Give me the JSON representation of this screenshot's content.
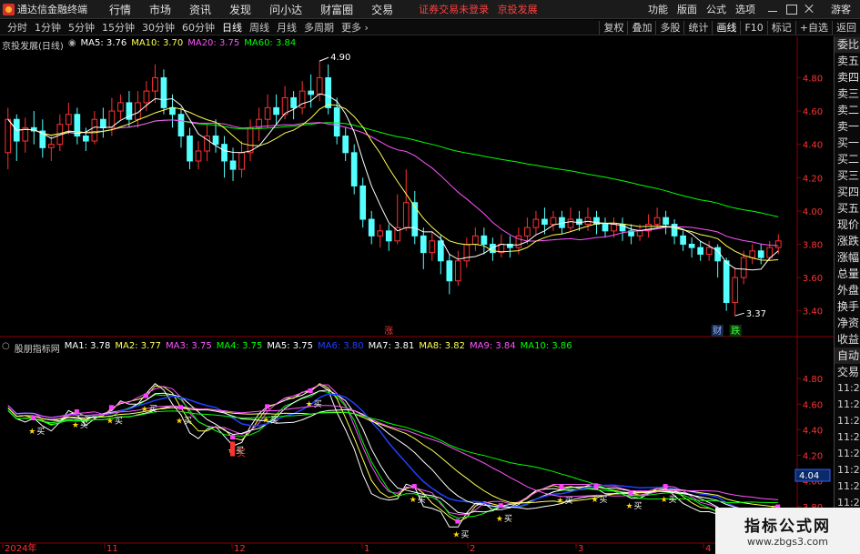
{
  "app": {
    "title": "通达信金融终端",
    "menu": [
      "行情",
      "市场",
      "资讯",
      "发现",
      "问小达",
      "财富圈",
      "交易"
    ],
    "notice": [
      "证券交易未登录",
      "京投发展"
    ],
    "right_menu": [
      "功能",
      "版面",
      "公式",
      "选项"
    ],
    "guest": "游客"
  },
  "toolbar": {
    "periods": [
      "分时",
      "1分钟",
      "5分钟",
      "15分钟",
      "30分钟",
      "60分钟",
      "日线",
      "周线",
      "月线",
      "多周期",
      "更多"
    ],
    "active_period": "日线",
    "buttons": [
      "复权",
      "叠加",
      "多股",
      "统计",
      "画线",
      "F10",
      "标记",
      "+自选",
      "返回"
    ]
  },
  "main_chart": {
    "title": "京投发展(日线)",
    "ma_labels": [
      {
        "text": "MA5: 3.76",
        "color": "#ffffff"
      },
      {
        "text": "MA10: 3.70",
        "color": "#ffff54"
      },
      {
        "text": "MA20: 3.75",
        "color": "#ff54ff"
      },
      {
        "text": "MA60: 3.84",
        "color": "#00ff00"
      }
    ],
    "y_ticks": [
      "4.80",
      "4.60",
      "4.40",
      "4.20",
      "4.00",
      "3.80",
      "3.60",
      "3.40"
    ],
    "high_label": "4.90",
    "low_label": "3.37",
    "zhang_marker": "涨",
    "cai_marker": "财",
    "die_marker": "跌"
  },
  "indicator": {
    "title": "股朋指标网",
    "ma_labels": [
      {
        "text": "MA1: 3.78",
        "color": "#ffffff"
      },
      {
        "text": "MA2: 3.77",
        "color": "#ffff54"
      },
      {
        "text": "MA3: 3.75",
        "color": "#ff54ff"
      },
      {
        "text": "MA4: 3.75",
        "color": "#00ff00"
      },
      {
        "text": "MA5: 3.75",
        "color": "#ffffff"
      },
      {
        "text": "MA6: 3.80",
        "color": "#2040ff"
      },
      {
        "text": "MA7: 3.81",
        "color": "#ffffff"
      },
      {
        "text": "MA8: 3.82",
        "color": "#ffff54"
      },
      {
        "text": "MA9: 3.84",
        "color": "#ff54ff"
      },
      {
        "text": "MA10: 3.86",
        "color": "#00ff00"
      }
    ],
    "y_ticks": [
      "4.80",
      "4.60",
      "4.40",
      "4.20",
      "4.00",
      "3.80",
      "3.60"
    ],
    "current_value": "4.04",
    "buy_label": "买",
    "buy_label_big": "买",
    "star": "★"
  },
  "time_axis": [
    "2024年",
    "11",
    "12",
    "1",
    "2",
    "3",
    "4"
  ],
  "side_panel": {
    "items": [
      "委比",
      "卖五",
      "卖四",
      "卖三",
      "卖二",
      "卖一",
      "买一",
      "买二",
      "买三",
      "买四",
      "买五",
      "现价",
      "涨跌",
      "涨幅",
      "总量",
      "外盘",
      "换手",
      "净资",
      "收益",
      "自动",
      "交易"
    ],
    "times": [
      "11:29",
      "11:29",
      "11:29",
      "11:29",
      "11:29",
      "11:29",
      "11:29",
      "11:29",
      "11:29"
    ]
  },
  "watermark": {
    "title": "指标公式网",
    "url": "www.zbgs3.com"
  },
  "colors": {
    "up": "#ff3232",
    "down": "#54ffff",
    "ma5": "#ffffff",
    "ma10": "#ffff54",
    "ma20": "#ff54ff",
    "ma60": "#00ff00",
    "buy_marker": "#ffd800",
    "axis": "#8b0000",
    "blue": "#2040ff"
  },
  "chart_data": {
    "type": "candlestick",
    "title": "京投发展(日线)",
    "y_range": [
      3.3,
      4.95
    ],
    "indicator_y_range": [
      3.55,
      4.95
    ],
    "candles": [
      [
        4.35,
        4.55,
        4.62,
        4.25
      ],
      [
        4.55,
        4.42,
        4.58,
        4.3
      ],
      [
        4.42,
        4.5,
        4.56,
        4.35
      ],
      [
        4.5,
        4.48,
        4.6,
        4.4
      ],
      [
        4.48,
        4.38,
        4.55,
        4.32
      ],
      [
        4.38,
        4.4,
        4.45,
        4.3
      ],
      [
        4.4,
        4.52,
        4.58,
        4.36
      ],
      [
        4.52,
        4.58,
        4.65,
        4.46
      ],
      [
        4.58,
        4.45,
        4.62,
        4.4
      ],
      [
        4.45,
        4.42,
        4.5,
        4.36
      ],
      [
        4.42,
        4.55,
        4.6,
        4.4
      ],
      [
        4.55,
        4.5,
        4.62,
        4.44
      ],
      [
        4.5,
        4.6,
        4.68,
        4.45
      ],
      [
        4.6,
        4.65,
        4.7,
        4.55
      ],
      [
        4.65,
        4.55,
        4.72,
        4.5
      ],
      [
        4.55,
        4.65,
        4.72,
        4.5
      ],
      [
        4.65,
        4.72,
        4.78,
        4.6
      ],
      [
        4.72,
        4.8,
        4.88,
        4.65
      ],
      [
        4.8,
        4.62,
        4.85,
        4.58
      ],
      [
        4.62,
        4.58,
        4.7,
        4.5
      ],
      [
        4.58,
        4.45,
        4.62,
        4.38
      ],
      [
        4.45,
        4.3,
        4.5,
        4.25
      ],
      [
        4.3,
        4.36,
        4.42,
        4.25
      ],
      [
        4.36,
        4.45,
        4.52,
        4.3
      ],
      [
        4.45,
        4.4,
        4.55,
        4.35
      ],
      [
        4.4,
        4.3,
        4.45,
        4.2
      ],
      [
        4.3,
        4.25,
        4.38,
        4.18
      ],
      [
        4.25,
        4.35,
        4.42,
        4.2
      ],
      [
        4.35,
        4.5,
        4.55,
        4.3
      ],
      [
        4.5,
        4.55,
        4.62,
        4.42
      ],
      [
        4.55,
        4.62,
        4.7,
        4.5
      ],
      [
        4.62,
        4.58,
        4.7,
        4.52
      ],
      [
        4.58,
        4.68,
        4.75,
        4.55
      ],
      [
        4.68,
        4.62,
        4.72,
        4.55
      ],
      [
        4.62,
        4.72,
        4.78,
        4.58
      ],
      [
        4.72,
        4.7,
        4.82,
        4.62
      ],
      [
        4.7,
        4.8,
        4.9,
        4.66
      ],
      [
        4.8,
        4.62,
        4.88,
        4.58
      ],
      [
        4.62,
        4.45,
        4.68,
        4.4
      ],
      [
        4.45,
        4.35,
        4.5,
        4.3
      ],
      [
        4.35,
        4.15,
        4.4,
        4.1
      ],
      [
        4.15,
        3.95,
        4.2,
        3.9
      ],
      [
        3.95,
        3.85,
        4.0,
        3.8
      ],
      [
        3.85,
        3.88,
        3.92,
        3.78
      ],
      [
        3.88,
        3.82,
        3.92,
        3.76
      ],
      [
        3.82,
        3.9,
        4.1,
        3.8
      ],
      [
        3.9,
        4.05,
        4.25,
        3.88
      ],
      [
        4.05,
        3.85,
        4.12,
        3.8
      ],
      [
        3.85,
        3.75,
        3.9,
        3.65
      ],
      [
        3.75,
        3.82,
        3.88,
        3.7
      ],
      [
        3.82,
        3.7,
        3.86,
        3.62
      ],
      [
        3.7,
        3.58,
        3.74,
        3.5
      ],
      [
        3.58,
        3.7,
        3.76,
        3.55
      ],
      [
        3.7,
        3.8,
        3.84,
        3.66
      ],
      [
        3.8,
        3.85,
        3.9,
        3.76
      ],
      [
        3.85,
        3.8,
        3.9,
        3.74
      ],
      [
        3.8,
        3.75,
        3.84,
        3.7
      ],
      [
        3.75,
        3.8,
        3.86,
        3.72
      ],
      [
        3.8,
        3.78,
        3.85,
        3.72
      ],
      [
        3.78,
        3.85,
        3.9,
        3.74
      ],
      [
        3.85,
        3.9,
        3.96,
        3.8
      ],
      [
        3.9,
        3.95,
        4.0,
        3.86
      ],
      [
        3.95,
        3.92,
        4.02,
        3.86
      ],
      [
        3.92,
        3.96,
        4.0,
        3.88
      ],
      [
        3.96,
        3.9,
        4.0,
        3.86
      ],
      [
        3.9,
        3.95,
        4.02,
        3.88
      ],
      [
        3.95,
        3.92,
        4.0,
        3.88
      ],
      [
        3.92,
        3.96,
        4.02,
        3.88
      ],
      [
        3.96,
        3.92,
        4.0,
        3.86
      ],
      [
        3.92,
        3.88,
        3.96,
        3.84
      ],
      [
        3.88,
        3.92,
        3.96,
        3.84
      ],
      [
        3.92,
        3.88,
        3.96,
        3.82
      ],
      [
        3.88,
        3.85,
        3.92,
        3.8
      ],
      [
        3.85,
        3.88,
        3.92,
        3.82
      ],
      [
        3.88,
        3.92,
        3.98,
        3.84
      ],
      [
        3.92,
        3.96,
        4.02,
        3.9
      ],
      [
        3.96,
        3.92,
        4.0,
        3.86
      ],
      [
        3.92,
        3.85,
        3.95,
        3.8
      ],
      [
        3.85,
        3.8,
        3.88,
        3.76
      ],
      [
        3.8,
        3.78,
        3.84,
        3.72
      ],
      [
        3.78,
        3.74,
        3.82,
        3.7
      ],
      [
        3.74,
        3.78,
        3.82,
        3.7
      ],
      [
        3.78,
        3.7,
        3.8,
        3.6
      ],
      [
        3.7,
        3.45,
        3.72,
        3.4
      ],
      [
        3.45,
        3.6,
        3.66,
        3.37
      ],
      [
        3.6,
        3.72,
        3.76,
        3.56
      ],
      [
        3.72,
        3.76,
        3.8,
        3.68
      ],
      [
        3.76,
        3.72,
        3.8,
        3.68
      ],
      [
        3.72,
        3.78,
        3.82,
        3.7
      ],
      [
        3.78,
        3.82,
        3.86,
        3.74
      ]
    ]
  }
}
